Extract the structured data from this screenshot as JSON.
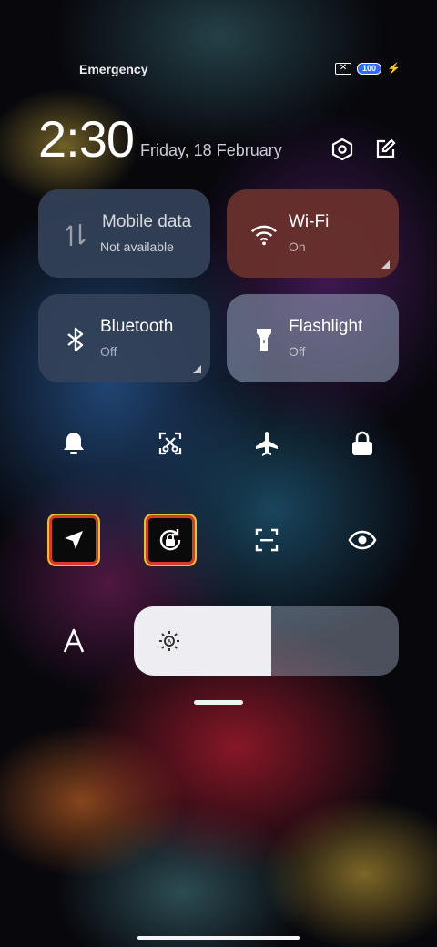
{
  "status_bar": {
    "carrier_text": "Emergency",
    "battery_level": "100",
    "sim_icon": "sim-off-icon",
    "charging_icon": "bolt-icon"
  },
  "header": {
    "time": "2:30",
    "date": "Friday, 18 February",
    "settings_icon": "settings-icon",
    "edit_icon": "edit-icon"
  },
  "tiles": {
    "mobile_data": {
      "title": "Mobile data",
      "status": "Not available"
    },
    "wifi": {
      "title": "Wi-Fi",
      "status": "On"
    },
    "bluetooth": {
      "title": "Bluetooth",
      "status": "Off"
    },
    "flashlight": {
      "title": "Flashlight",
      "status": "Off"
    }
  },
  "quick_toggles": [
    "bell-icon",
    "screenshot-icon",
    "airplane-icon",
    "lock-icon",
    "location-icon",
    "rotation-lock-icon",
    "scanner-icon",
    "eye-icon"
  ],
  "brightness": {
    "level": 0.52,
    "auto_icon": "auto-brightness-icon"
  },
  "colors": {
    "wifi_tile": "#68302c",
    "tile": "#34425a",
    "battery": "#2f6bff"
  }
}
